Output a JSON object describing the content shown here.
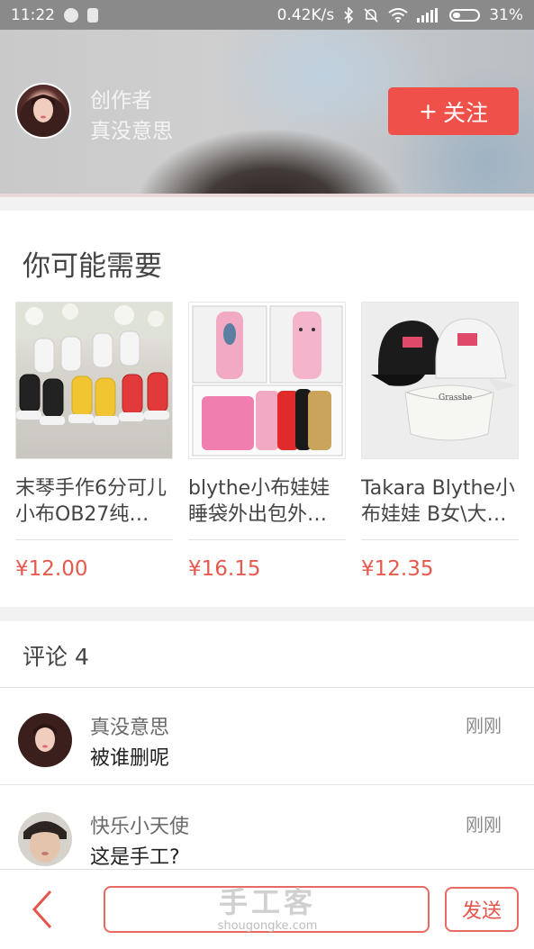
{
  "status_bar": {
    "time": "11:22",
    "network_speed": "0.42K/s",
    "battery": "31%",
    "battery_level": 0.31,
    "icons": [
      "notification-icon",
      "app-icon",
      "bluetooth-icon",
      "mute-icon",
      "wifi-icon",
      "signal-icon",
      "battery-icon"
    ]
  },
  "header": {
    "creator_tag": "创作者",
    "creator_name": "真没意思",
    "follow_label": "关注",
    "follow_symbol": "+"
  },
  "recommend": {
    "title": "你可能需要",
    "products": [
      {
        "name": "末琴手作6分可儿小布OB27纯…",
        "price": "¥12.00"
      },
      {
        "name": "blythe小布娃娃睡袋外出包外…",
        "price": "¥16.15"
      },
      {
        "name": "Takara Blythe小布娃娃 B女\\大…",
        "price": "¥12.35"
      }
    ]
  },
  "comments": {
    "title": "评论 4",
    "items": [
      {
        "user": "真没意思",
        "text": "被谁删呢",
        "time": "刚刚"
      },
      {
        "user": "快乐小天使",
        "text": "这是手工?",
        "time": "刚刚"
      }
    ]
  },
  "bottom_bar": {
    "input_placeholder": "",
    "send_label": "发送"
  },
  "watermark": {
    "title": "手工客",
    "url": "shougongke.com"
  },
  "colors": {
    "accent": "#f0504a",
    "price": "#e55a4c"
  }
}
